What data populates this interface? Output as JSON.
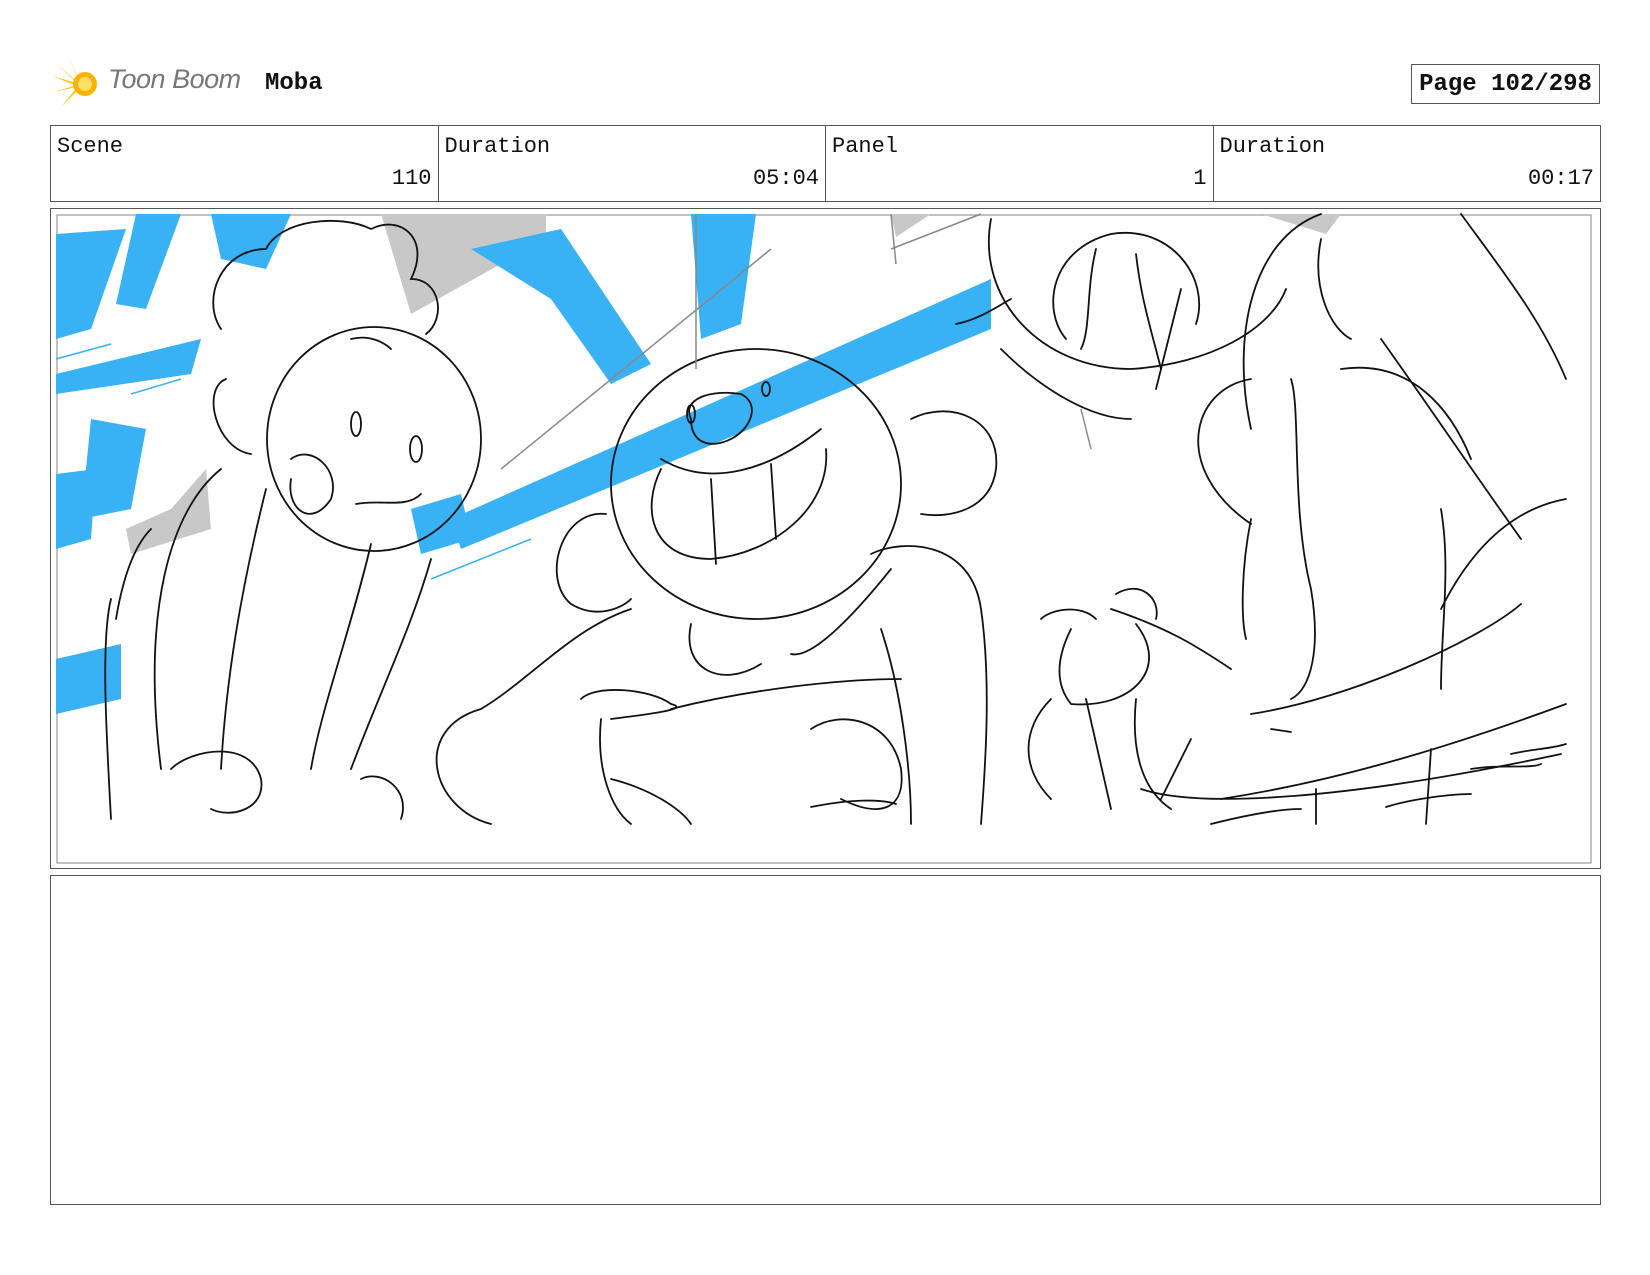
{
  "header": {
    "logo_text": "Toon Boom",
    "project": "Moba",
    "page": "Page 102/298"
  },
  "info": {
    "scene_label": "Scene",
    "scene_value": "110",
    "scene_duration_label": "Duration",
    "scene_duration_value": "05:04",
    "panel_label": "Panel",
    "panel_value": "1",
    "panel_duration_label": "Duration",
    "panel_duration_value": "00:17"
  },
  "colors": {
    "accent_blue": "#39b1f5",
    "shadow_gray": "#c8c8c8",
    "logo_yellow": "#ffc61a"
  },
  "frame": {
    "content": "storyboard-sketch"
  },
  "notes": {
    "text": ""
  }
}
